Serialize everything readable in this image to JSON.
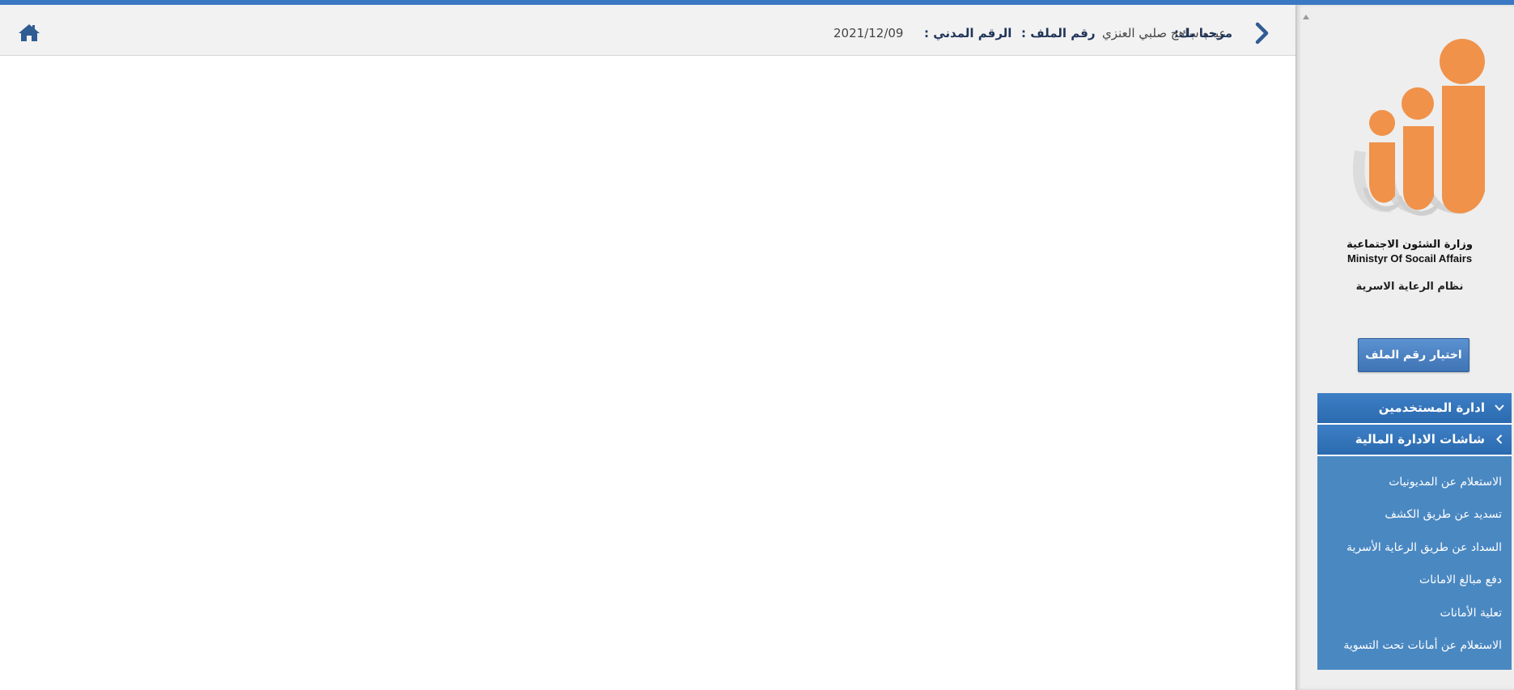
{
  "header": {
    "welcome_label": "مرحبا بك:",
    "user_name": "عيده ساهج صلبي العنزي",
    "file_number_label": "رقم الملف :",
    "file_number_value": "",
    "civil_id_label": "الرقم المدني :",
    "date": "2021/12/09",
    "home_icon": "home-icon",
    "back_icon": "chevron-left-icon"
  },
  "sidebar": {
    "org_name_ar": "وزارة الشئون الاجتماعية",
    "org_name_en": "Ministyr Of Socail Affairs",
    "system_name": "نظام الرعاية الاسرية",
    "select_file_label": "اختيار رقم الملف",
    "menu": [
      {
        "label": "ادارة المستخدمين",
        "expanded": false
      },
      {
        "label": "شاشات الادارة المالية",
        "expanded": true,
        "items": [
          "الاستعلام عن المديونيات",
          "تسديد عن طريق الكشف",
          "السداد عن طريق الرعاية الأسرية",
          "دفع مبالغ الامانات",
          "تعلية الأمانات",
          "الاستعلام عن أمانات تحت التسوية"
        ]
      }
    ]
  },
  "colors": {
    "accent": "#3b78c4",
    "menu_header": "#2f6fb3",
    "submenu_bg": "#4a88c2",
    "logo_orange": "#f0924a",
    "logo_gray": "#d6d6d6",
    "header_text": "#1f3559"
  }
}
